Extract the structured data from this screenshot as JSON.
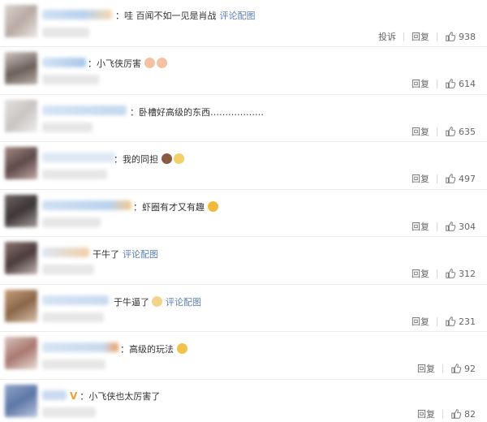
{
  "labels": {
    "report": "投诉",
    "reply": "回复",
    "view_image": "评论配图"
  },
  "comments": [
    {
      "text": "哇 百闻不如一见是肖战",
      "likes": "938",
      "has_report": true,
      "has_image_link": true
    },
    {
      "text": "小飞侠厉害",
      "likes": "614",
      "has_report": false,
      "has_image_link": false
    },
    {
      "text": "卧槽好高级的东西………………",
      "likes": "635",
      "has_report": false,
      "has_image_link": false
    },
    {
      "text": "我的同担",
      "likes": "497",
      "has_report": false,
      "has_image_link": false
    },
    {
      "text": "虾圈有才又有趣",
      "likes": "304",
      "has_report": false,
      "has_image_link": false
    },
    {
      "text": "干牛了",
      "likes": "312",
      "has_report": false,
      "has_image_link": true
    },
    {
      "text": "于牛逼了",
      "likes": "231",
      "has_report": false,
      "has_image_link": true
    },
    {
      "text": "高级的玩法",
      "likes": "92",
      "has_report": false,
      "has_image_link": false
    },
    {
      "text": "小飞侠也太厉害了",
      "likes": "82",
      "has_report": false,
      "has_image_link": false
    }
  ],
  "colors": {
    "link": "#5b7fb0",
    "action": "#666666",
    "divider": "#ececec",
    "verified": "#e8a13a"
  },
  "icons": {
    "like": "thumbs-up-icon",
    "emoji": "emoji-icon"
  }
}
